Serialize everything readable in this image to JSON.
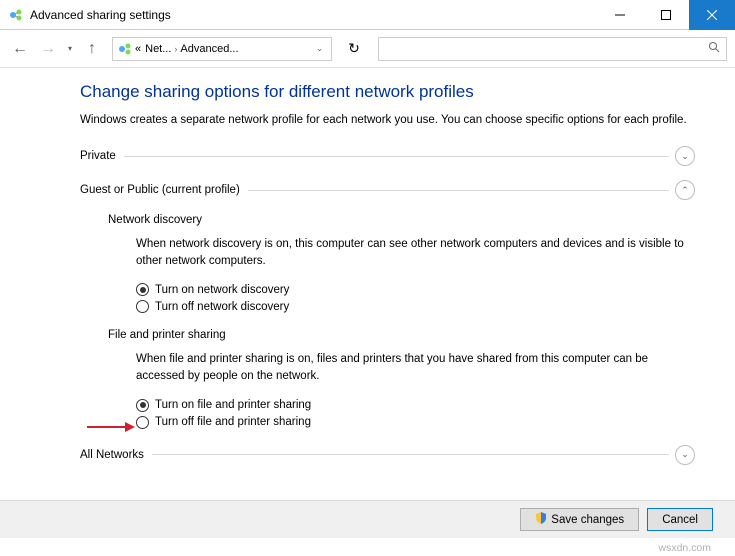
{
  "window": {
    "title": "Advanced sharing settings"
  },
  "breadcrumb": {
    "prefix": "«",
    "part1": "Net...",
    "part2": "Advanced..."
  },
  "page": {
    "heading": "Change sharing options for different network profiles",
    "subtext": "Windows creates a separate network profile for each network you use. You can choose specific options for each profile."
  },
  "sections": {
    "private": {
      "title": "Private"
    },
    "guest": {
      "title": "Guest or Public (current profile)",
      "discovery": {
        "title": "Network discovery",
        "desc": "When network discovery is on, this computer can see other network computers and devices and is visible to other network computers.",
        "opt_on": "Turn on network discovery",
        "opt_off": "Turn off network discovery"
      },
      "fileprint": {
        "title": "File and printer sharing",
        "desc": "When file and printer sharing is on, files and printers that you have shared from this computer can be accessed by people on the network.",
        "opt_on": "Turn on file and printer sharing",
        "opt_off": "Turn off file and printer sharing"
      }
    },
    "all": {
      "title": "All Networks"
    }
  },
  "footer": {
    "save": "Save changes",
    "cancel": "Cancel"
  },
  "watermark": "wsxdn.com"
}
